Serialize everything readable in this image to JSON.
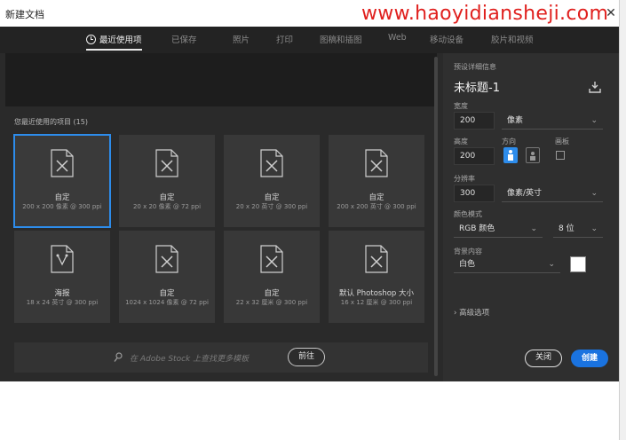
{
  "window": {
    "title": "新建文档",
    "watermark": "www.haoyidiansheji.com",
    "close_glyph": "✕"
  },
  "tabs": [
    {
      "label": "最近使用项",
      "active": true,
      "icon": "clock-icon"
    },
    {
      "label": "已保存",
      "active": false
    },
    {
      "label": "照片",
      "active": false
    },
    {
      "label": "打印",
      "active": false
    },
    {
      "label": "图稿和插图",
      "active": false
    },
    {
      "label": "Web",
      "active": false
    },
    {
      "label": "移动设备",
      "active": false
    },
    {
      "label": "胶片和视频",
      "active": false
    }
  ],
  "recent": {
    "label": "您最近使用的项目 (15)",
    "items": [
      {
        "name": "自定",
        "size": "200 x 200 像素 @ 300 ppi",
        "selected": true,
        "icon": "blank-document-icon"
      },
      {
        "name": "自定",
        "size": "20 x 20 像素 @ 72 ppi",
        "selected": false,
        "icon": "blank-document-icon"
      },
      {
        "name": "自定",
        "size": "20 x 20 英寸 @ 300 ppi",
        "selected": false,
        "icon": "blank-document-icon"
      },
      {
        "name": "自定",
        "size": "200 x 200 英寸 @ 300 ppi",
        "selected": false,
        "icon": "blank-document-icon"
      },
      {
        "name": "海报",
        "size": "18 x 24 英寸 @ 300 ppi",
        "selected": false,
        "icon": "artboard-document-icon"
      },
      {
        "name": "自定",
        "size": "1024 x 1024 像素 @ 72 ppi",
        "selected": false,
        "icon": "blank-document-icon"
      },
      {
        "name": "自定",
        "size": "22 x 32 厘米 @ 300 ppi",
        "selected": false,
        "icon": "blank-document-icon"
      },
      {
        "name": "默认 Photoshop 大小",
        "size": "16 x 12 厘米 @ 300 ppi",
        "selected": false,
        "icon": "blank-document-icon"
      }
    ]
  },
  "stock": {
    "placeholder": "在 Adobe Stock 上查找更多模板",
    "go_label": "前往"
  },
  "details": {
    "section_label": "预设详细信息",
    "doc_name": "未标题-1",
    "width_label": "宽度",
    "width_value": "200",
    "width_unit": "像素",
    "height_label": "高度",
    "height_value": "200",
    "orientation_label": "方向",
    "artboard_label": "画板",
    "resolution_label": "分辨率",
    "resolution_value": "300",
    "resolution_unit": "像素/英寸",
    "color_mode_label": "颜色模式",
    "color_mode_value": "RGB 颜色",
    "bit_depth_value": "8 位",
    "background_label": "背景内容",
    "background_value": "白色",
    "background_swatch": "#ffffff",
    "advanced_label": "› 高级选项",
    "close_label": "关闭",
    "create_label": "创建"
  },
  "colors": {
    "accent": "#2d8ceb",
    "create_button": "#1a73e0",
    "watermark": "#e0201e"
  }
}
